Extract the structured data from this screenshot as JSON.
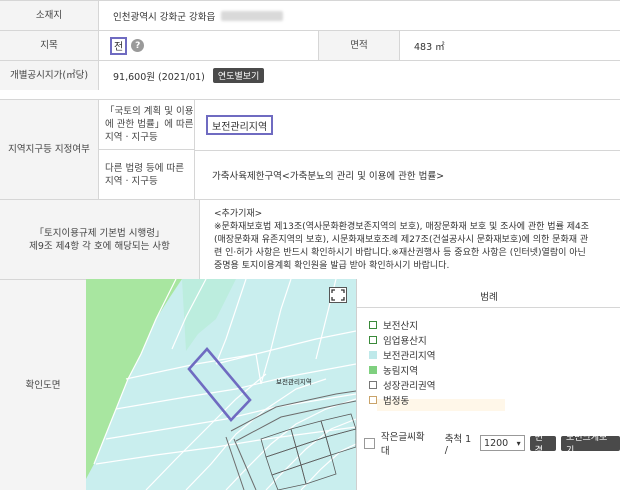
{
  "rows": {
    "address": {
      "label": "소재지",
      "value": "인천광역시 강화군 강화읍"
    },
    "jimok": {
      "label": "지목",
      "value": "전",
      "area_label": "면적",
      "area_value": "483 ㎡"
    },
    "price": {
      "label": "개별공시지가(㎡당)",
      "value": "91,600원 (2021/01)",
      "button": "연도별보기"
    },
    "zoning": {
      "label": "지역지구등 지정여부",
      "sub1_label": "「국토의 계획 및 이용에 관한 법률」에 따른 지역 · 지구등",
      "sub1_value": "보전관리지역",
      "sub2_label": "다른 법령 등에 따른 지역 · 지구등",
      "sub2_value": "가축사육제한구역<가축분뇨의 관리 및 이용에 관한 법률>"
    },
    "regulation": {
      "label_line1": "「토지이용규제 기본법 시행령」",
      "label_line2": "제9조 제4항 각 호에 해당되는 사항",
      "notice": [
        "<추가기재>",
        "※문화재보호법 제13조(역사문화환경보존지역의 보호), 매장문화재 보호 및 조사에 관한 법률 제4조",
        "(매장문화재 유존지역의 보호), 시문화재보호조례 제27조(건설공사시 문화재보호)에 의한 문화재 관",
        "련 인·허가 사항은 반드시 확인하시기 바랍니다.※재산권행사 등 중요한 사항은 (인터넷)열람이 아닌",
        "중명용 토지이용계획 확인원을 발급 받아 확인하시기 바랍니다."
      ]
    },
    "map": {
      "label": "확인도면",
      "parcel_label": "보전관리지역"
    }
  },
  "legend": {
    "title": "범례",
    "items": [
      {
        "label": "보전산지",
        "color": "#ffffff",
        "border": "#3a8a3a"
      },
      {
        "label": "임업용산지",
        "color": "#ffffff",
        "border": "#3a8a3a"
      },
      {
        "label": "보전관리지역",
        "color": "#bfe9ea",
        "border": "#bfe9ea"
      },
      {
        "label": "농림지역",
        "color": "#7fd07f",
        "border": "#7fd07f"
      },
      {
        "label": "성장관리권역",
        "color": "#ffffff",
        "border": "#777777"
      },
      {
        "label": "법정동",
        "color": "#ffffff",
        "border": "#c9a36a"
      }
    ]
  },
  "controls": {
    "small_text_label": "작은글씨확대",
    "scale_label": "축척 1 /",
    "scale_value": "1200",
    "change_button": "변경",
    "enlarge_button": "도면크게보기"
  },
  "colors": {
    "highlight": "#6f6bc1",
    "map_bg": "#c9eeee",
    "forest": "#a8e6a0"
  }
}
